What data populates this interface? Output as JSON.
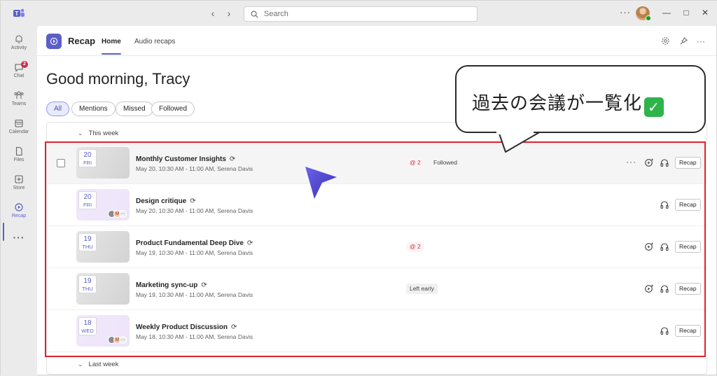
{
  "titlebar": {
    "search_placeholder": "Search",
    "more": "···",
    "window_controls": [
      "minimize-icon",
      "maximize-icon",
      "close-icon"
    ]
  },
  "rail": {
    "items": [
      {
        "label": "Activity",
        "icon": "bell-icon"
      },
      {
        "label": "Chat",
        "icon": "chat-icon",
        "badge": "2"
      },
      {
        "label": "Teams",
        "icon": "teams-icon"
      },
      {
        "label": "Calendar",
        "icon": "calendar-icon"
      },
      {
        "label": "Files",
        "icon": "file-icon"
      },
      {
        "label": "Store",
        "icon": "store-icon"
      },
      {
        "label": "Recap",
        "icon": "recap-icon",
        "active": true
      }
    ],
    "more": "···"
  },
  "header": {
    "app_name": "Recap",
    "tabs": [
      {
        "label": "Home",
        "active": true
      },
      {
        "label": "Audio recaps"
      }
    ]
  },
  "greeting": "Good morning, Tracy",
  "filters": [
    "All",
    "Mentions",
    "Missed",
    "Followed"
  ],
  "sections": {
    "this_week": "This week",
    "last_week": "Last week"
  },
  "meetings": [
    {
      "day": "20",
      "weekday": "FRI",
      "title": "Monthly Customer Insights",
      "subtitle": "May 20, 10:30 AM - 11:00 AM, Serena Davis",
      "mentions": "@ 2",
      "status": "Followed",
      "action": "Recap"
    },
    {
      "day": "20",
      "weekday": "FRI",
      "title": "Design critique",
      "subtitle": "May 20, 10:30 AM - 11:00 AM, Serena Davis",
      "action": "Recap",
      "participant_initial": "M"
    },
    {
      "day": "19",
      "weekday": "THU",
      "title": "Product Fundamental Deep Dive",
      "subtitle": "May 19, 10:30 AM - 11:00 AM, Serena Davis",
      "mentions": "@ 2",
      "action": "Recap"
    },
    {
      "day": "19",
      "weekday": "THU",
      "title": "Marketing sync-up",
      "subtitle": "May 19, 10:30 AM - 11:00 AM, Serena Davis",
      "status": "Left early",
      "action": "Recap"
    },
    {
      "day": "18",
      "weekday": "WED",
      "title": "Weekly Product Discussion",
      "subtitle": "May 18, 10:30 AM - 11:00 AM, Serena Davis",
      "action": "Recap",
      "participant_initial": "M"
    }
  ],
  "annotation": {
    "callout_text": "過去の会議が一覧化",
    "callout_emoji": "✓",
    "colors": {
      "frame": "#e0232e",
      "accent": "#5b5fc7"
    }
  }
}
